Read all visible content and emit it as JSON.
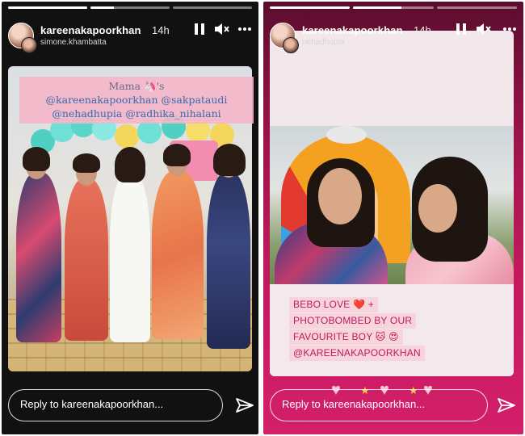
{
  "left_story": {
    "progress": [
      1.0,
      0.3,
      0.0
    ],
    "username": "kareenakapoorkhan",
    "time": "14h",
    "subtitle": "simone.khambatta",
    "caption": [
      "Mama 🦄's",
      "@kareenakapoorkhan @sakpataudi",
      "@nehadhupia @radhika_nihalani"
    ],
    "reply_placeholder": "Reply to kareenakapoorkhan..."
  },
  "right_story": {
    "progress": [
      1.0,
      0.6,
      0.0
    ],
    "username": "kareenakapoorkhan",
    "time": "14h",
    "subtitle": "nehadhupia",
    "caption": [
      "BEBO LOVE ❤️ +",
      "PHOTOBOMBED BY OUR",
      "FAVOURITE BOY 🐱 😍",
      "@KAREENAKAPOORKHAN"
    ],
    "reply_placeholder": "Reply to kareenakapoorkhan..."
  },
  "icons": {
    "pause": "pause-icon",
    "mute": "mute-icon",
    "more": "more-icon",
    "send": "send-icon"
  },
  "colors": {
    "right_bg": "#c0195c",
    "caption_pink": "#f7d3dc",
    "mention_blue": "#3a6ab0"
  }
}
